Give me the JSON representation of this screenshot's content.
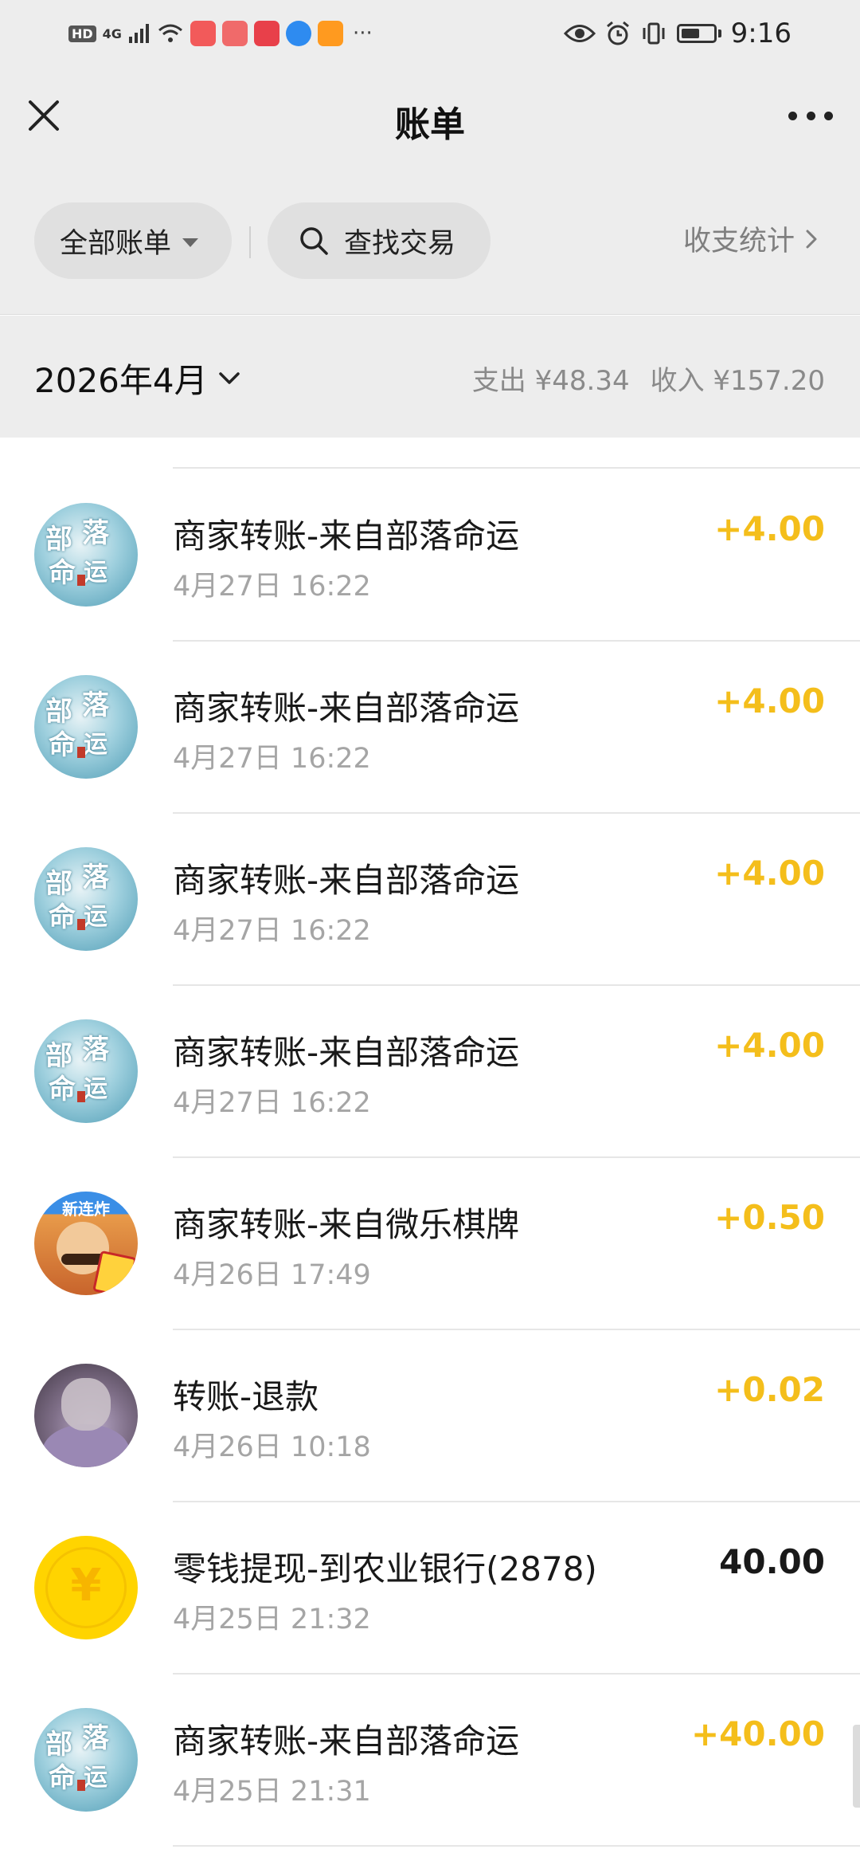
{
  "status_bar": {
    "hd": "HD",
    "network": "4G",
    "time": "9:16",
    "more": "···"
  },
  "nav": {
    "title": "账单"
  },
  "filters": {
    "all_bills": "全部账单",
    "search": "查找交易",
    "stats": "收支统计"
  },
  "month": {
    "label": "2026年4月",
    "expense": "支出 ¥48.34",
    "income": "收入 ¥157.20"
  },
  "colors": {
    "income_amount": "#f4be1b",
    "expense_amount": "#191919",
    "background_gray": "#ededed"
  },
  "transactions": [
    {
      "title": "商家转账-来自部落命运",
      "time": "4月27日 16:22",
      "amount": "+4.00",
      "type": "income",
      "avatar": "tribe-destiny-avatar"
    },
    {
      "title": "商家转账-来自部落命运",
      "time": "4月27日 16:22",
      "amount": "+4.00",
      "type": "income",
      "avatar": "tribe-destiny-avatar"
    },
    {
      "title": "商家转账-来自部落命运",
      "time": "4月27日 16:22",
      "amount": "+4.00",
      "type": "income",
      "avatar": "tribe-destiny-avatar"
    },
    {
      "title": "商家转账-来自部落命运",
      "time": "4月27日 16:22",
      "amount": "+4.00",
      "type": "income",
      "avatar": "tribe-destiny-avatar"
    },
    {
      "title": "商家转账-来自微乐棋牌",
      "time": "4月26日 17:49",
      "amount": "+0.50",
      "type": "income",
      "avatar": "weile-chess-avatar",
      "avatar_banner": "新连炸"
    },
    {
      "title": "转账-退款",
      "time": "4月26日 10:18",
      "amount": "+0.02",
      "type": "income",
      "avatar": "person-avatar"
    },
    {
      "title": "零钱提现-到农业银行(2878)",
      "time": "4月25日 21:32",
      "amount": "40.00",
      "type": "expense",
      "avatar": "yen-coin-avatar"
    },
    {
      "title": "商家转账-来自部落命运",
      "time": "4月25日 21:31",
      "amount": "+40.00",
      "type": "income",
      "avatar": "tribe-destiny-avatar"
    }
  ],
  "avatar_glyphs": {
    "tribe": [
      "部",
      "落",
      "命",
      "运"
    ],
    "coin": "¥"
  }
}
